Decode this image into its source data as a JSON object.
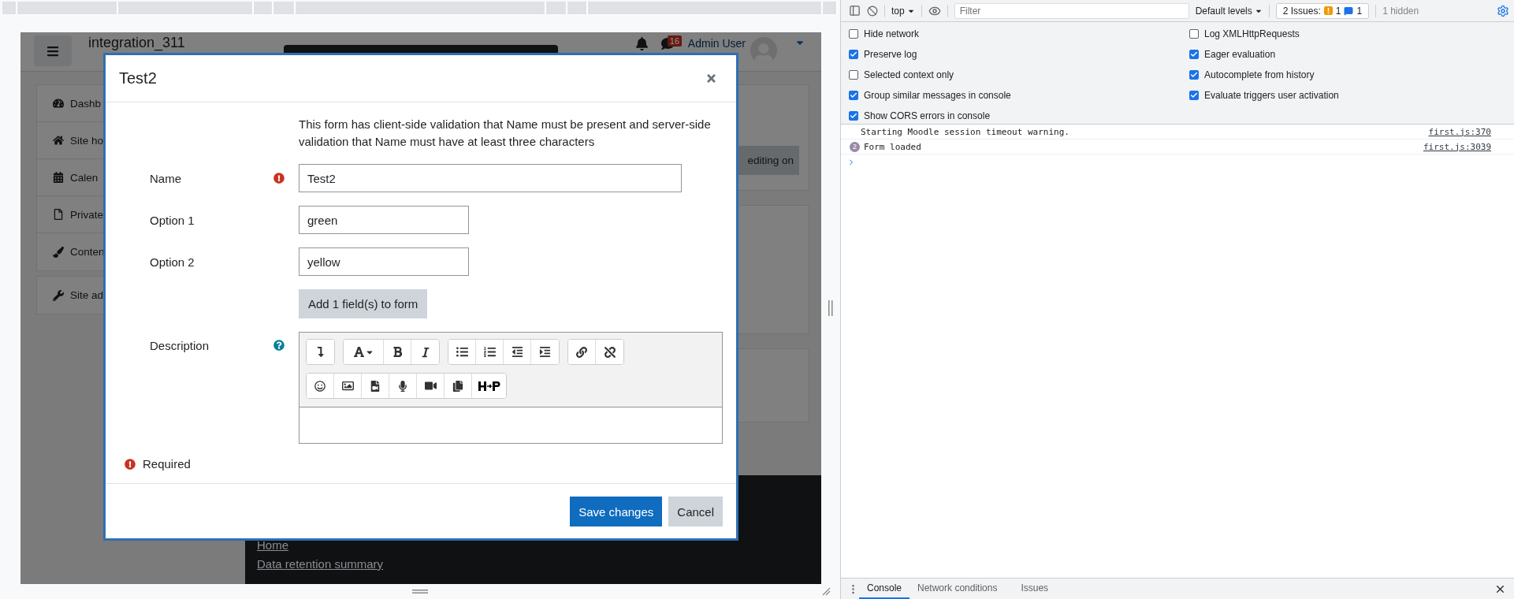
{
  "page": {
    "site_name": "integration_311",
    "notification_count": "16",
    "user_name": "Admin User",
    "nav_items": [
      {
        "kind": "dashboard",
        "label": "Dashb"
      },
      {
        "kind": "home",
        "label": "Site ho"
      },
      {
        "kind": "calendar",
        "label": "Calen"
      },
      {
        "kind": "file",
        "label": "Private"
      },
      {
        "kind": "brush",
        "label": "Conten"
      },
      {
        "kind": "wrench",
        "label": "Site ad"
      }
    ],
    "edit_button": "editing on",
    "footer_links": [
      "Home",
      "Data retention summary"
    ]
  },
  "dialog": {
    "title": "Test2",
    "intro": "This form has client-side validation that Name must be present and server-side validation that Name must have at least three characters",
    "fields": [
      {
        "kind": "long-text",
        "label": "Name",
        "value": "Test2",
        "invalid": true
      },
      {
        "kind": "short-text",
        "label": "Option 1",
        "value": "green"
      },
      {
        "kind": "short-text",
        "label": "Option 2",
        "value": "yellow"
      },
      {
        "kind": "button",
        "label": "Add 1 field(s) to form"
      },
      {
        "kind": "editor",
        "label": "Description",
        "help": true
      }
    ],
    "required_note": "Required",
    "buttons": [
      {
        "kind": "primary",
        "label": "Save changes"
      },
      {
        "kind": "secondary",
        "label": "Cancel"
      }
    ]
  },
  "devtools": {
    "context": "top",
    "filter_placeholder": "Filter",
    "levels": "Default levels",
    "issues_label": "2 Issues:",
    "warning_count": "1",
    "info_count": "1",
    "hidden": "1 hidden",
    "settings_left": [
      {
        "label": "Hide network",
        "checked": false
      },
      {
        "label": "Preserve log",
        "checked": true
      },
      {
        "label": "Selected context only",
        "checked": false
      },
      {
        "label": "Group similar messages in console",
        "checked": true
      },
      {
        "label": "Show CORS errors in console",
        "checked": true
      }
    ],
    "settings_right": [
      {
        "label": "Log XMLHttpRequests",
        "checked": false
      },
      {
        "label": "Eager evaluation",
        "checked": true
      },
      {
        "label": "Autocomplete from history",
        "checked": true
      },
      {
        "label": "Evaluate triggers user activation",
        "checked": true
      }
    ],
    "messages": [
      {
        "text": "Starting Moodle session timeout warning.",
        "source": "first.js:370"
      },
      {
        "count": "2",
        "text": "Form loaded",
        "source": "first.js:3039"
      }
    ],
    "drawer_tabs": [
      {
        "label": "Console",
        "selected": true
      },
      {
        "label": "Network conditions",
        "selected": false
      },
      {
        "label": "Issues",
        "selected": false
      }
    ]
  }
}
